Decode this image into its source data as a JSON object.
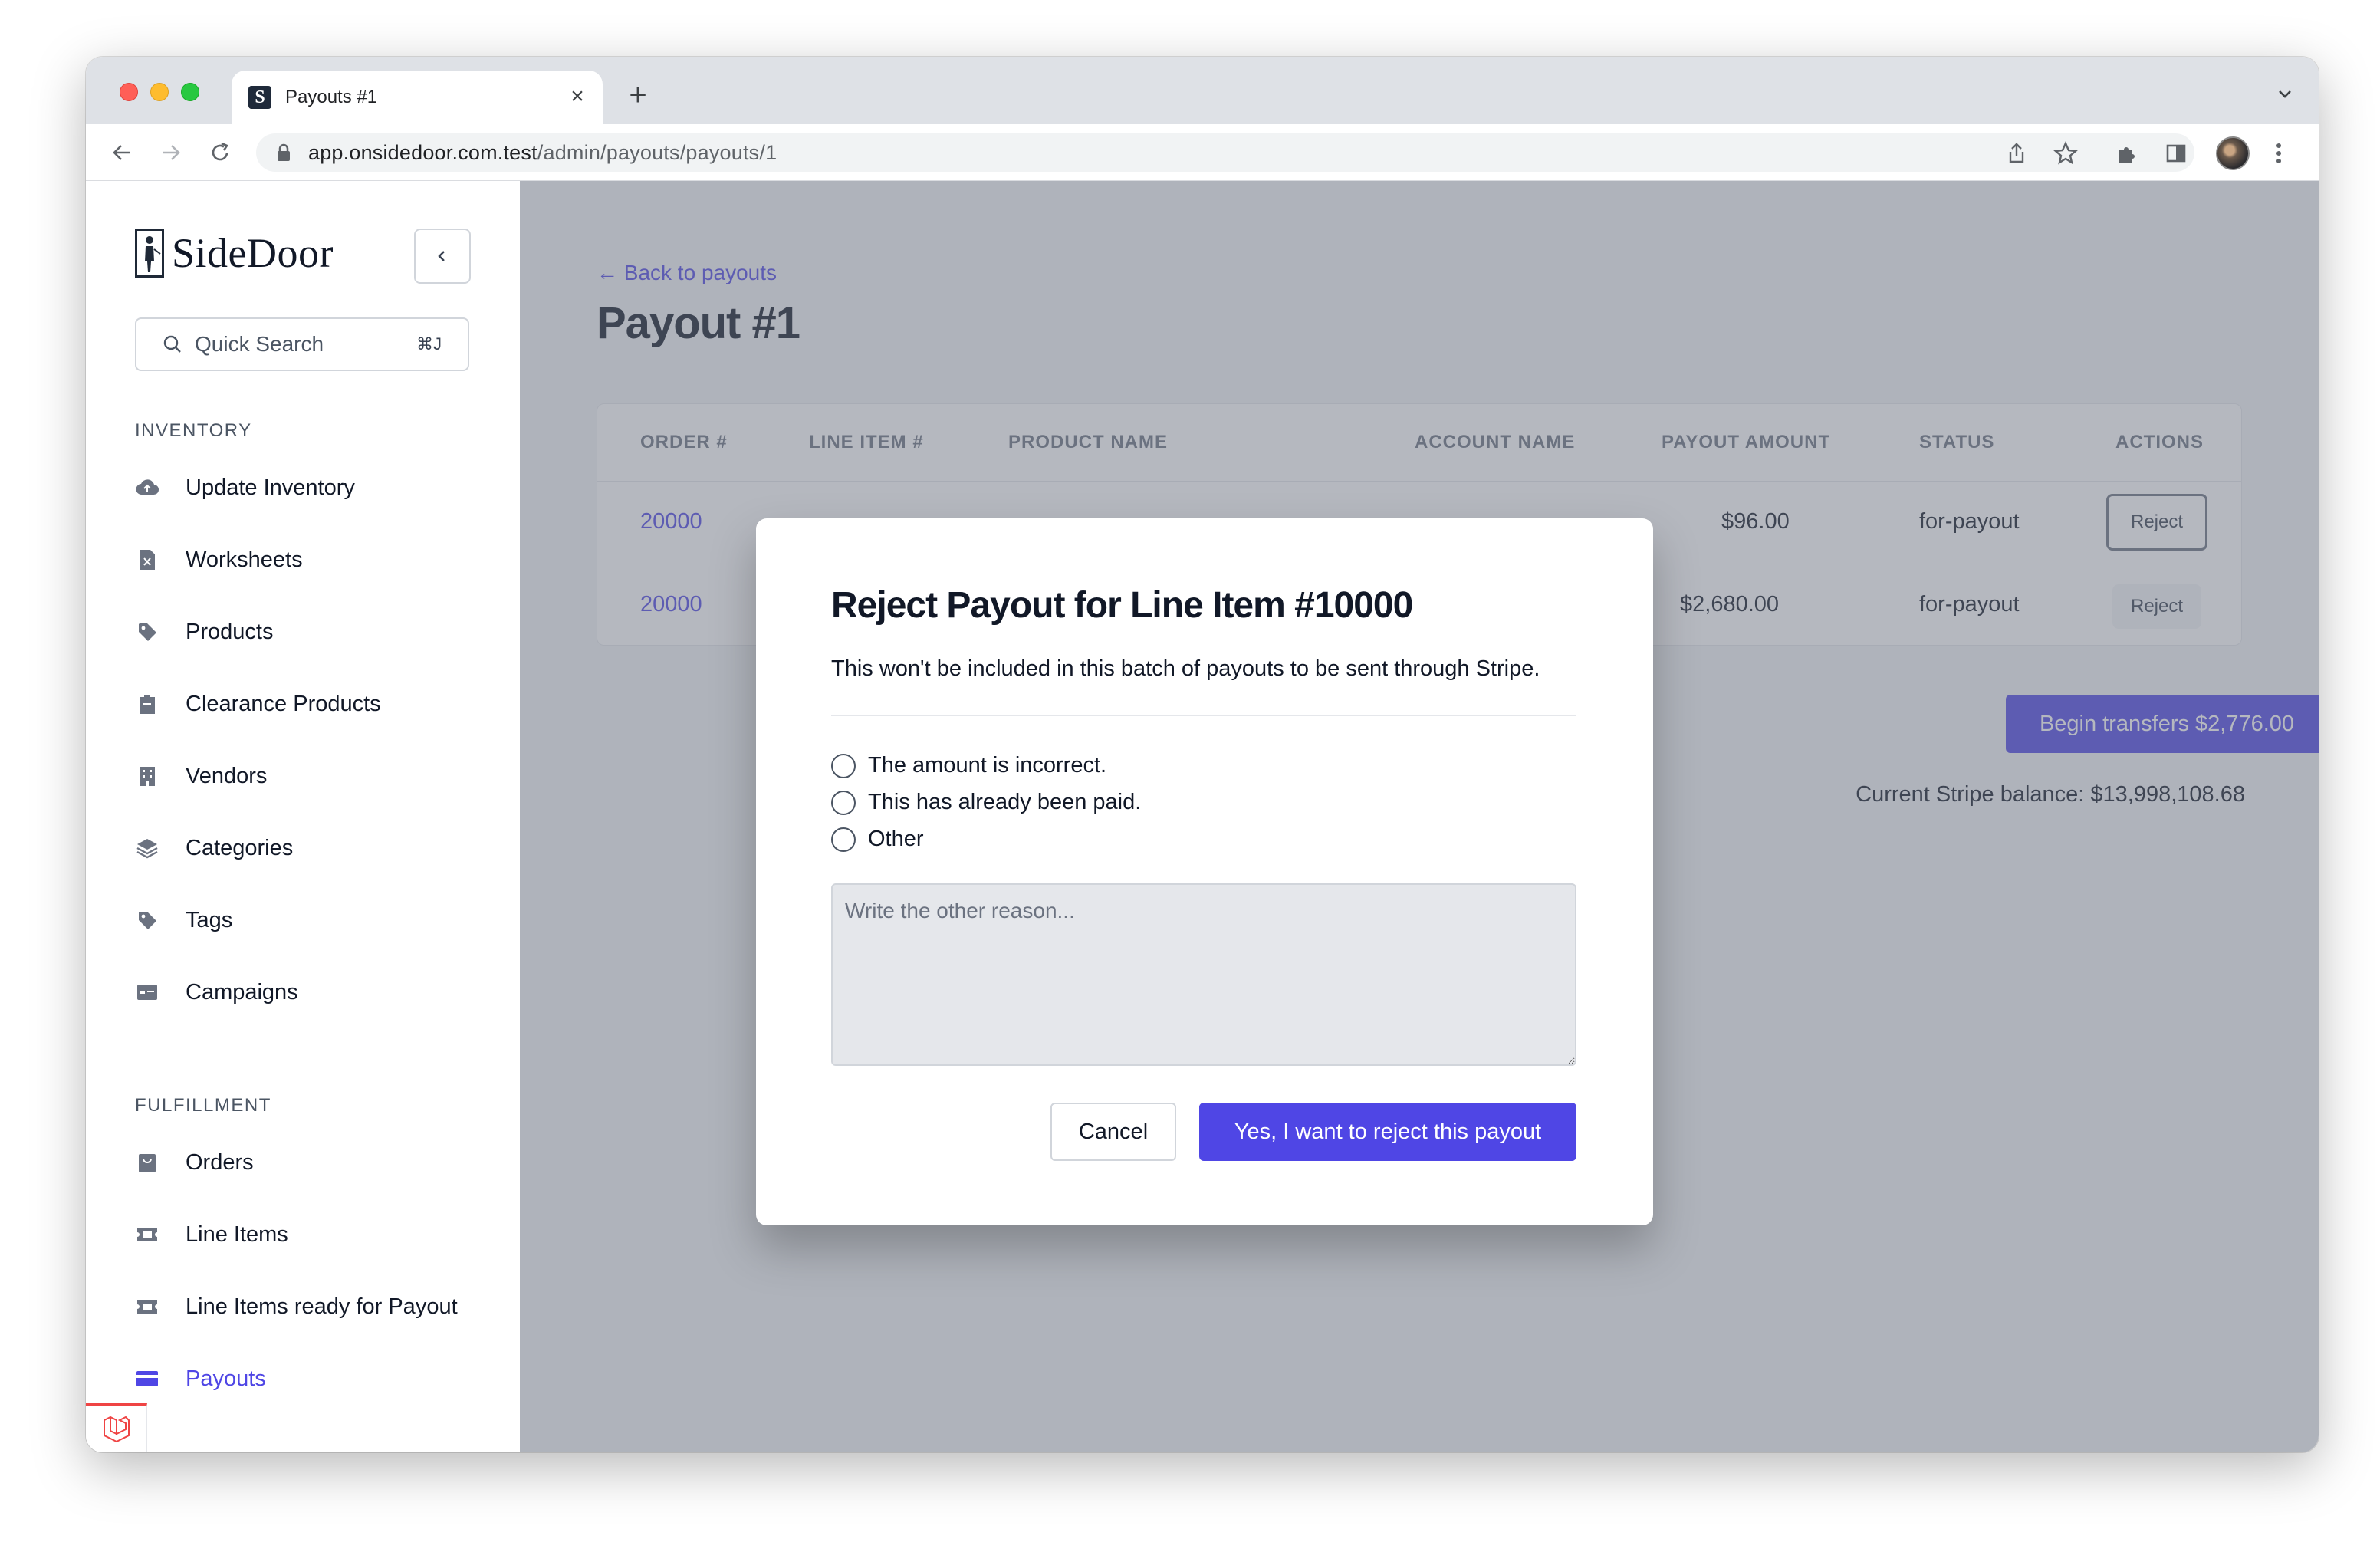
{
  "browser": {
    "tab_title": "Payouts #1",
    "tab_favicon_letter": "S",
    "url_host": "app.onsidedoor.com.test",
    "url_path": "/admin/payouts/payouts/1"
  },
  "sidebar": {
    "logo_text": "SideDoor",
    "collapse_icon": "chevron-left-icon",
    "quick_search": {
      "label": "Quick Search",
      "shortcut": "⌘J"
    },
    "sections": [
      {
        "title": "INVENTORY",
        "items": [
          {
            "label": "Update Inventory",
            "icon": "cloud-upload-icon"
          },
          {
            "label": "Worksheets",
            "icon": "spreadsheet-icon"
          },
          {
            "label": "Products",
            "icon": "tag-icon"
          },
          {
            "label": "Clearance Products",
            "icon": "clipboard-icon"
          },
          {
            "label": "Vendors",
            "icon": "building-icon"
          },
          {
            "label": "Categories",
            "icon": "layers-icon"
          },
          {
            "label": "Tags",
            "icon": "tag-icon"
          },
          {
            "label": "Campaigns",
            "icon": "id-card-icon"
          }
        ]
      },
      {
        "title": "FULFILLMENT",
        "items": [
          {
            "label": "Orders",
            "icon": "shopping-bag-icon"
          },
          {
            "label": "Line Items",
            "icon": "ticket-icon"
          },
          {
            "label": "Line Items ready for Payout",
            "icon": "ticket-icon"
          },
          {
            "label": "Payouts",
            "icon": "credit-card-icon",
            "active": true
          }
        ]
      }
    ]
  },
  "page": {
    "back_link": "← Back to payouts",
    "title": "Payout #1",
    "table": {
      "columns": [
        "ORDER #",
        "LINE ITEM #",
        "PRODUCT NAME",
        "ACCOUNT NAME",
        "PAYOUT AMOUNT",
        "STATUS",
        "ACTIONS"
      ],
      "rows": [
        {
          "order": "20000",
          "payout_amount": "$96.00",
          "status": "for-payout",
          "action": "Reject"
        },
        {
          "order": "20000",
          "payout_amount": "$2,680.00",
          "status": "for-payout",
          "action": "Reject"
        }
      ]
    },
    "begin_transfers": "Begin transfers $2,776.00",
    "balance": "Current Stripe balance: $13,998,108.68"
  },
  "modal": {
    "title": "Reject Payout for Line Item #10000",
    "description": "This won't be included in this batch of payouts to be sent through Stripe.",
    "options": [
      "The amount is incorrect.",
      "This has already been paid.",
      "Other"
    ],
    "textarea_placeholder": "Write the other reason...",
    "cancel_label": "Cancel",
    "confirm_label": "Yes, I want to reject this payout"
  },
  "colors": {
    "accent": "#4f46e5",
    "overlay": "#6b7280",
    "laravel": "#ef4444"
  }
}
